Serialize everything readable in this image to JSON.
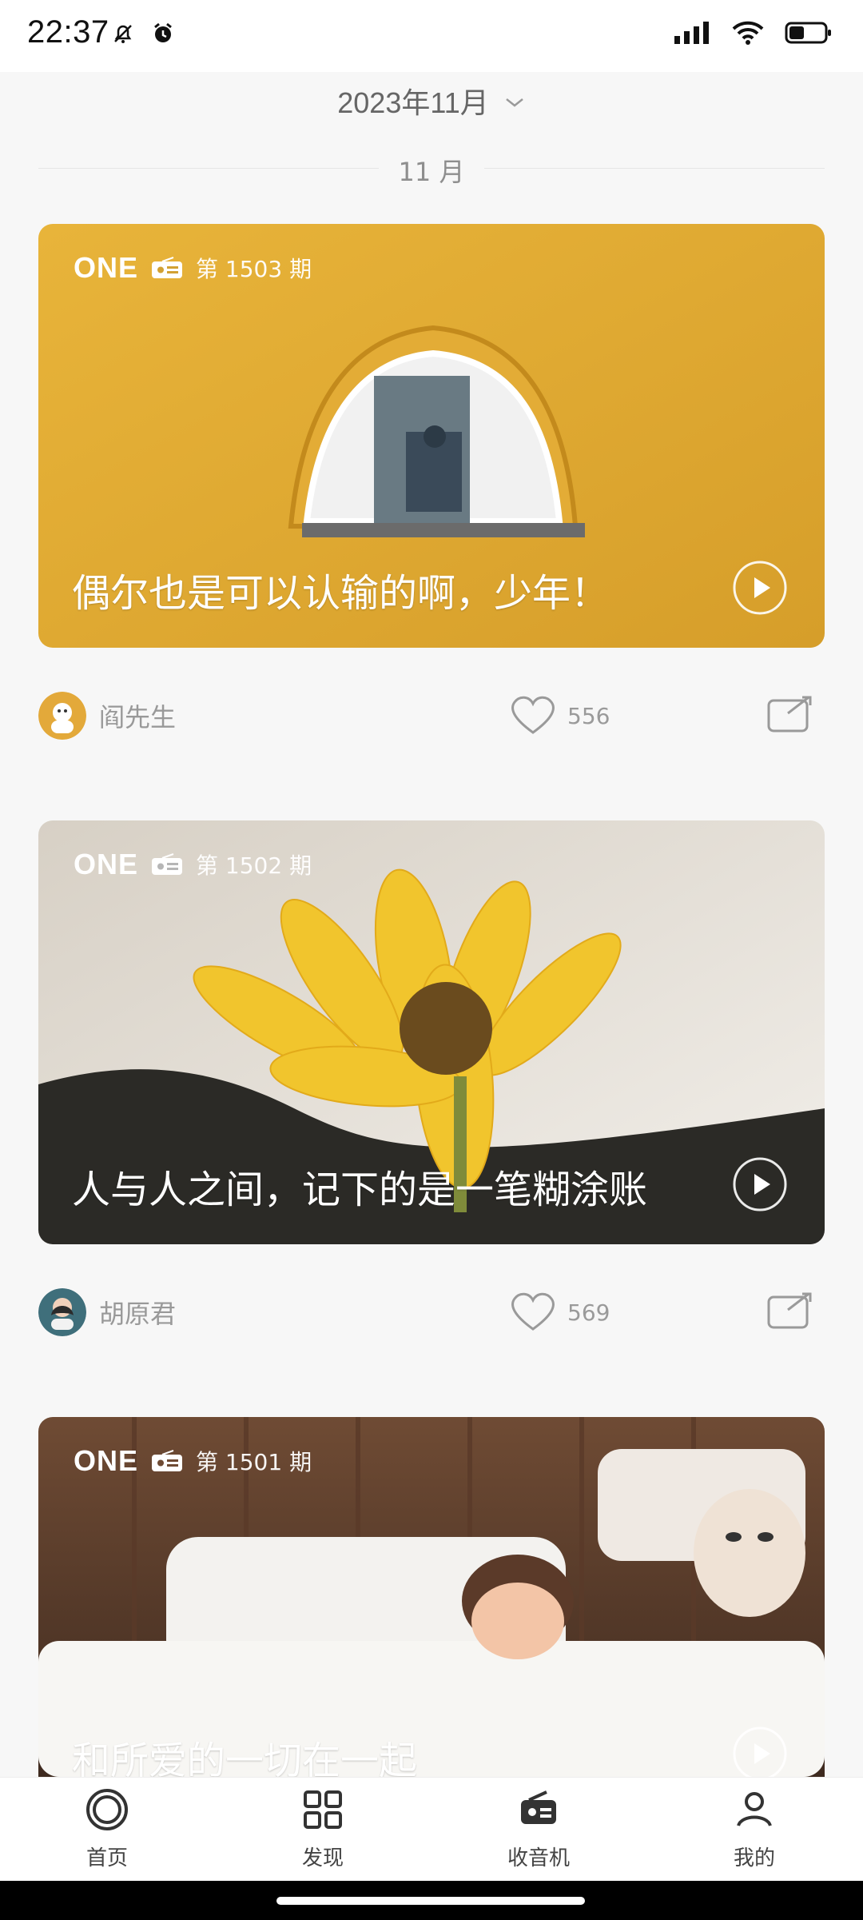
{
  "status_bar": {
    "time": "22:37",
    "left_icons": [
      "bell-off-icon",
      "alarm-icon"
    ],
    "right_icons": [
      "signal-icon",
      "wifi-icon",
      "battery-icon"
    ]
  },
  "header": {
    "month_title": "2023年11月",
    "section_label": "11 月"
  },
  "cards": [
    {
      "brand": "ONE",
      "issue": "第 1503 期",
      "quote": "偶尔也是可以认输的啊，少年！",
      "author": "阎先生",
      "likes": "556",
      "theme_color": "#E0A92F"
    },
    {
      "brand": "ONE",
      "issue": "第 1502 期",
      "quote": "人与人之间，记下的是一笔糊涂账",
      "author": "胡原君",
      "likes": "569",
      "theme_color": "#C6A12C"
    },
    {
      "brand": "ONE",
      "issue": "第 1501 期",
      "quote": "和所爱的一切在一起",
      "theme_color": "#7C5E46"
    }
  ],
  "bottom_nav": {
    "items": [
      {
        "label": "首页",
        "icon": "home-icon"
      },
      {
        "label": "发现",
        "icon": "grid-icon"
      },
      {
        "label": "收音机",
        "icon": "radio-icon"
      },
      {
        "label": "我的",
        "icon": "profile-icon"
      }
    ],
    "active_index": 2
  }
}
